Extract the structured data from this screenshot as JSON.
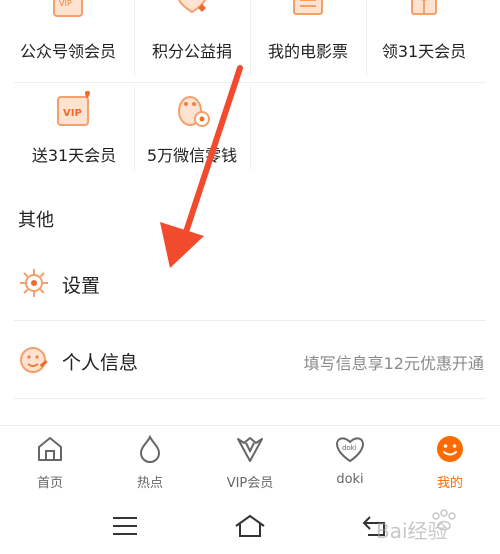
{
  "grid": {
    "items": [
      {
        "label": "公众号领会员",
        "icon": "vip-card-icon",
        "badge": "VIP"
      },
      {
        "label": "积分公益捐",
        "icon": "heart-donate-icon"
      },
      {
        "label": "我的电影票",
        "icon": "movie-ticket-icon"
      },
      {
        "label": "领31天会员",
        "icon": "gift-icon"
      },
      {
        "label": "送31天会员",
        "icon": "vip-gift-card-icon",
        "badge": "VIP"
      },
      {
        "label": "5万微信零钱",
        "icon": "penguin-coin-icon"
      }
    ]
  },
  "section": {
    "title": "其他"
  },
  "menu": {
    "settings": {
      "label": "设置",
      "icon": "gear-icon"
    },
    "profile": {
      "label": "个人信息",
      "icon": "smile-edit-icon",
      "promo": "填写信息享12元优惠开通"
    }
  },
  "tabbar": {
    "tabs": [
      {
        "label": "首页",
        "icon": "home-icon"
      },
      {
        "label": "热点",
        "icon": "flame-icon"
      },
      {
        "label": "VIP会员",
        "icon": "vip-crown-icon"
      },
      {
        "label": "doki",
        "icon": "doki-heart-icon",
        "icon_text": "doki"
      },
      {
        "label": "我的",
        "icon": "smiley-face-icon",
        "active": true
      }
    ]
  },
  "watermark": {
    "text": "Bai经验"
  },
  "colors": {
    "accent": "#ff6a00",
    "icon_orange": "#f4a06a",
    "arrow_red": "#f24a2c",
    "muted": "#8a8a8a"
  }
}
